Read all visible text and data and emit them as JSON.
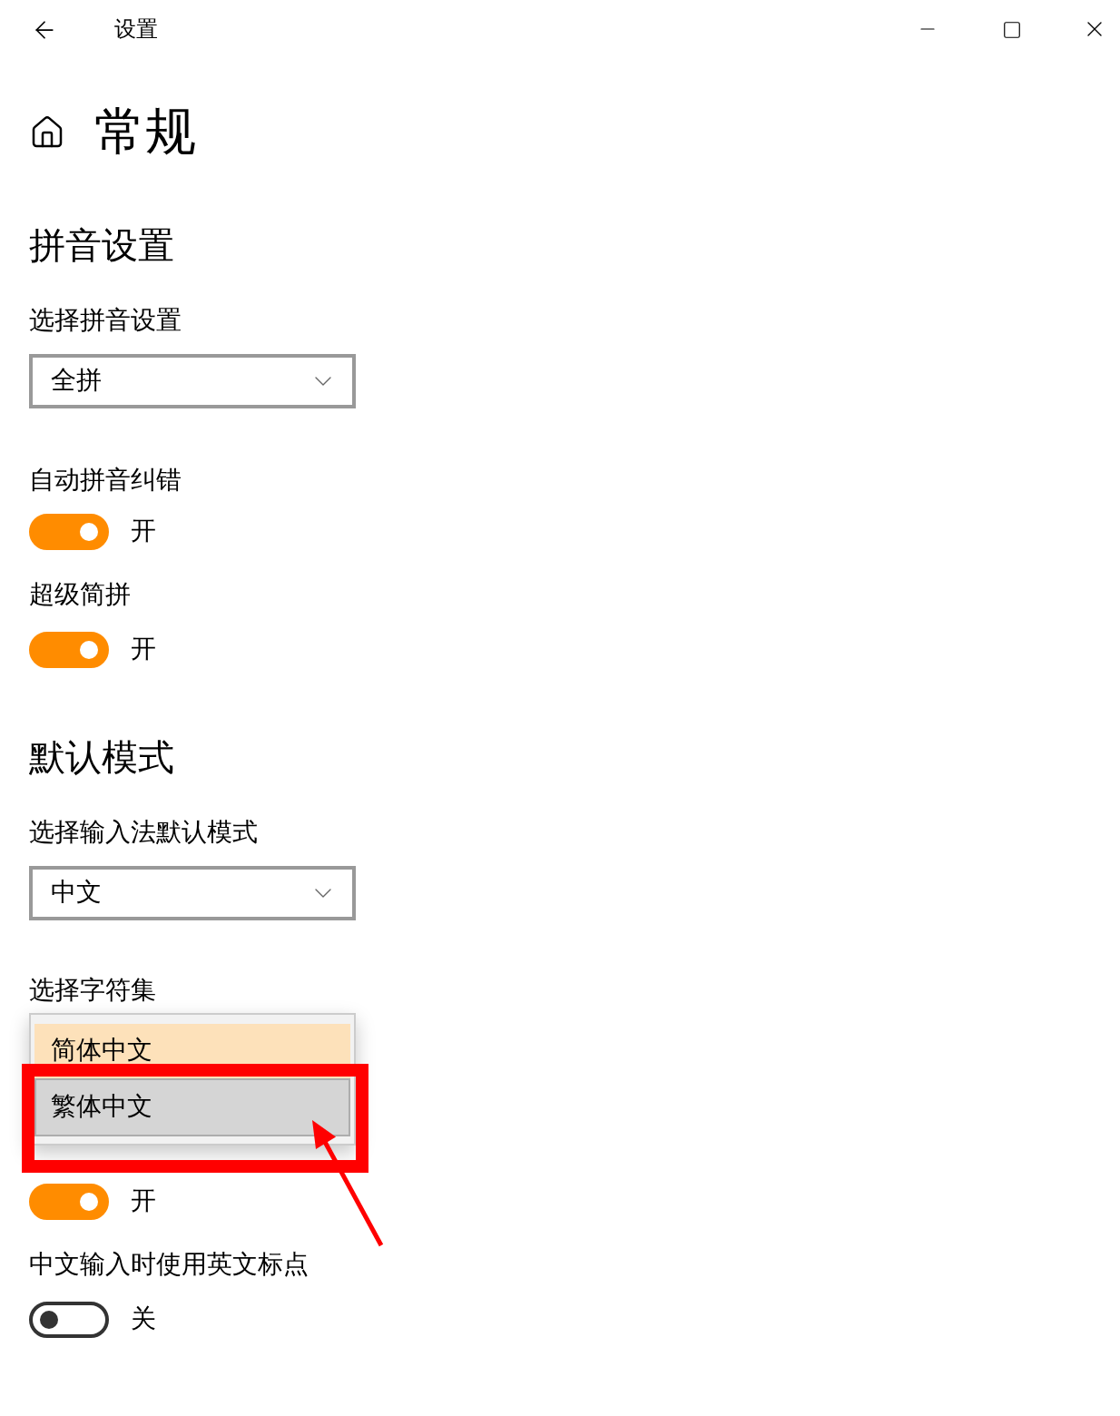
{
  "window": {
    "title": "设置"
  },
  "page": {
    "title": "常规"
  },
  "sections": [
    {
      "heading": "拼音设置",
      "settings": [
        {
          "kind": "dropdown",
          "label": "选择拼音设置",
          "value": "全拼"
        },
        {
          "kind": "toggle",
          "label": "自动拼音纠错",
          "on": true,
          "state_text": "开"
        },
        {
          "kind": "toggle",
          "label": "超级简拼",
          "on": true,
          "state_text": "开"
        }
      ]
    },
    {
      "heading": "默认模式",
      "settings": [
        {
          "kind": "dropdown",
          "label": "选择输入法默认模式",
          "value": "中文"
        },
        {
          "kind": "open_dropdown",
          "label": "选择字符集",
          "options": [
            {
              "label": "简体中文",
              "selected": true,
              "highlighted": false
            },
            {
              "label": "繁体中文",
              "selected": false,
              "highlighted": true
            }
          ]
        },
        {
          "kind": "toggle",
          "on": true,
          "state_text": "开"
        },
        {
          "kind": "toggle",
          "label": "中文输入时使用英文标点",
          "on": false,
          "state_text": "关"
        }
      ]
    }
  ]
}
